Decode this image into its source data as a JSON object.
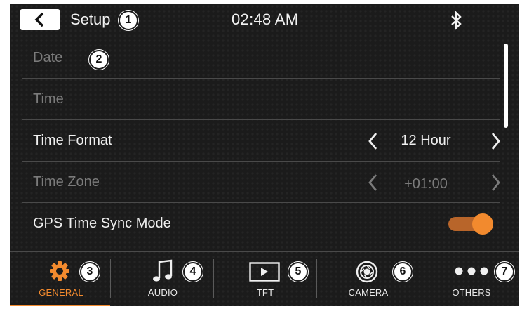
{
  "header": {
    "title": "Setup",
    "clock": "02:48 AM",
    "back_icon": "chevron-left-icon",
    "bluetooth_icon": "bluetooth-icon"
  },
  "callouts": [
    "1",
    "2",
    "3",
    "4",
    "5",
    "6",
    "7"
  ],
  "settings": {
    "date": {
      "label": "Date"
    },
    "time": {
      "label": "Time"
    },
    "time_format": {
      "label": "Time Format",
      "value": "12 Hour"
    },
    "time_zone": {
      "label": "Time Zone",
      "value": "+01:00"
    },
    "gps_sync": {
      "label": "GPS Time Sync Mode",
      "enabled": true
    }
  },
  "tabs": [
    {
      "label": "GENERAL",
      "icon": "gear-icon",
      "active": true
    },
    {
      "label": "AUDIO",
      "icon": "music-note-icon",
      "active": false
    },
    {
      "label": "TFT",
      "icon": "play-icon",
      "active": false
    },
    {
      "label": "CAMERA",
      "icon": "camera-lens-icon",
      "active": false
    },
    {
      "label": "OTHERS",
      "icon": "more-dots-icon",
      "active": false
    }
  ],
  "colors": {
    "accent": "#f28a2e",
    "background": "#1b1b1b",
    "text": "#f0f0f0",
    "disabled_text": "#7b7b7b"
  }
}
